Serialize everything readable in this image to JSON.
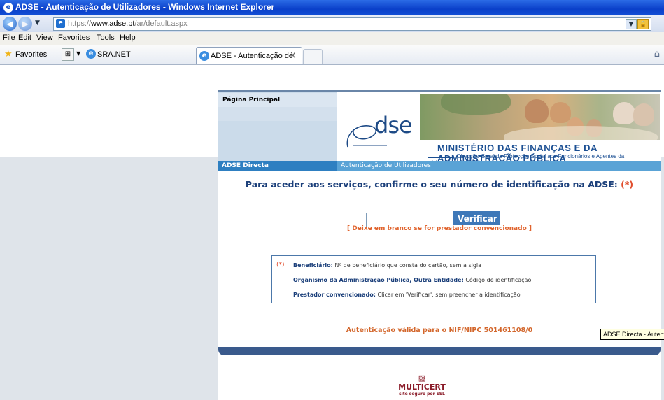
{
  "window": {
    "title": "ADSE - Autenticação de Utilizadores - Windows Internet Explorer"
  },
  "address_bar": {
    "url_prefix": "https://",
    "url_domain": "www.adse.pt",
    "url_path": "/ar/default.aspx"
  },
  "menu": [
    "File",
    "Edit",
    "View",
    "Favorites",
    "Tools",
    "Help"
  ],
  "favorites_bar": {
    "favorites_label": "Favorites",
    "favorite_link": "SRA.NET"
  },
  "tab": {
    "label": "ADSE - Autenticação de ...",
    "close": "X"
  },
  "page": {
    "sidebar_link": "Página Principal",
    "logo_text": "dse",
    "ministry": "MINISTÉRIO DAS FINANÇAS E DA ADMINISTRAÇÃO PÚBLICA",
    "direction": "Direcção-Geral de Protecção Social aos Funcionários e Agentes da Administração Pública",
    "bar_left": "ADSE Directa",
    "bar_right": "Autenticação de Utilizadores",
    "prompt": "Para aceder aos serviços, confirme o seu número de identificação na ADSE: ",
    "prompt_marker": "(*)",
    "input_value": "",
    "verify_button": "Verificar",
    "hint": "[ Deixe em branco se for prestador convencionado ]",
    "info": {
      "marker": "(*)",
      "rows": [
        {
          "label": "Beneficiário:",
          "text": " Nº de beneficiário que consta do cartão, sem a sigla"
        },
        {
          "label": "Organismo da Administração Pública, Outra Entidade:",
          "text": " Código de identificação"
        },
        {
          "label": "Prestador convencionado:",
          "text": " Clicar em 'Verificar', sem preencher a identificação"
        }
      ]
    },
    "nif_line": "Autenticação válida para o NIF/NIPC 501461108/0",
    "multicert": "MULTICERT",
    "multicert_sub": "site seguro por SSL"
  },
  "tooltip": "ADSE Directa - Autenticação de Utilizadores"
}
